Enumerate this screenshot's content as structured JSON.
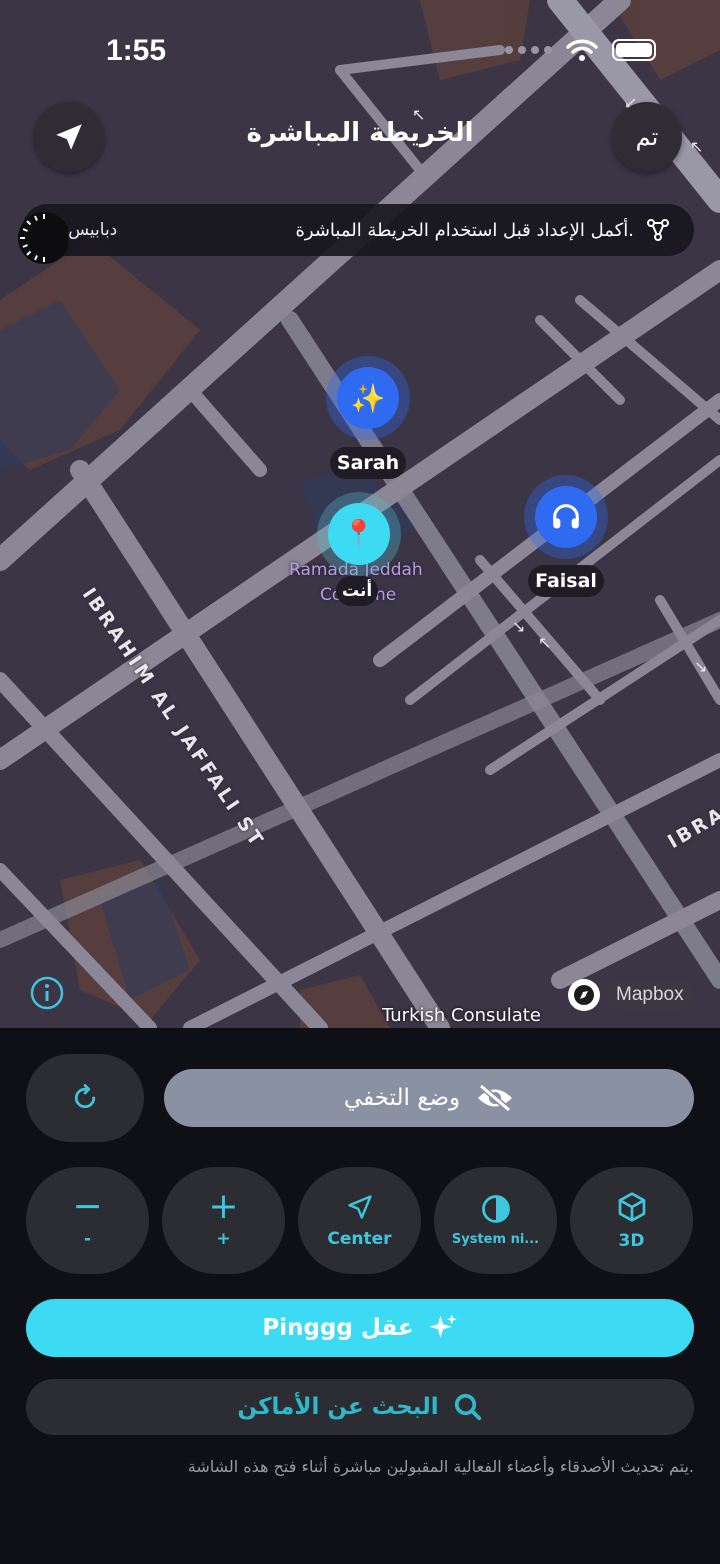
{
  "status_bar": {
    "time": "1:55"
  },
  "map": {
    "title": "الخريطة المباشرة",
    "done_label": "تم",
    "banner": {
      "message": "أكمل الإعداد قبل استخدام الخريطة المباشرة.",
      "countdown": "3 دبابيس"
    },
    "streets": [
      "IBRAHIM AL JAFFALI ST",
      "IBRA"
    ],
    "poi": [
      "Ramada Jeddah",
      "Co",
      "ne"
    ],
    "attribution": "Turkish Consulate",
    "mapbox_label": "Mapbox",
    "markers": [
      {
        "name": "Sarah",
        "icon": "sparkles-icon",
        "emoji": "✨"
      },
      {
        "name": "أنت",
        "icon": "pin-icon",
        "emoji": "📍"
      },
      {
        "name": "Faisal",
        "icon": "headphones-icon",
        "emoji": "🎧"
      }
    ]
  },
  "panel": {
    "stealth_label": "وضع التخفي",
    "controls": [
      {
        "label": "−",
        "sub": "-"
      },
      {
        "label": "+",
        "sub": "+"
      },
      {
        "label": "Center"
      },
      {
        "label": "System ni..."
      },
      {
        "label": "3D"
      }
    ],
    "ping_label": "Pinggg عقل",
    "search_label": "البحث عن الأماكن",
    "footnote": "يتم تحديث الأصدقاء وأعضاء الفعالية المقبولين مباشرة أثناء فتح هذه الشاشة."
  },
  "colors": {
    "accent": "#3ddbf3",
    "teal_text": "#3ec7dc",
    "stealth": "#8a91a3",
    "marker_blue": "#2f6bf0"
  }
}
